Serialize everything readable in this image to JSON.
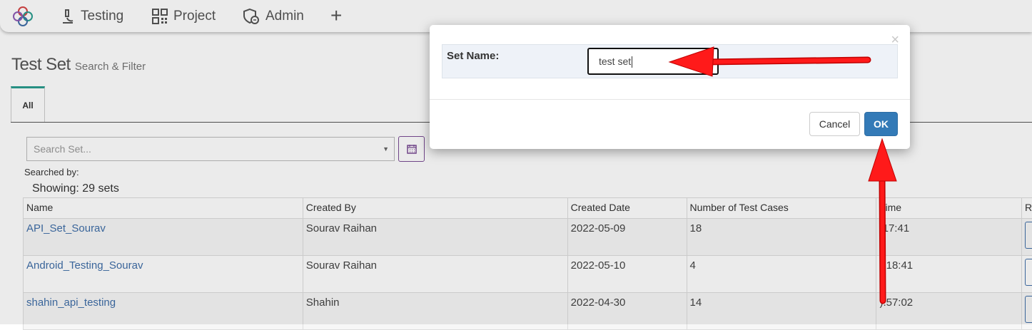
{
  "nav": {
    "items": [
      {
        "label": "Testing",
        "icon": "microscope-icon"
      },
      {
        "label": "Project",
        "icon": "qr-code-icon"
      },
      {
        "label": "Admin",
        "icon": "admin-shield-icon"
      }
    ],
    "add_label": "+"
  },
  "page": {
    "title": "Test Set",
    "subtitle": "Search & Filter",
    "tabs": [
      {
        "label": "All",
        "active": true
      }
    ],
    "search": {
      "placeholder": "Search Set..."
    },
    "searched_by": "Searched by:",
    "showing": "Showing: 29 sets"
  },
  "table": {
    "headers": [
      "Name",
      "Created By",
      "Created Date",
      "Number of Test Cases",
      "Time",
      "R"
    ],
    "rows": [
      {
        "name": "API_Set_Sourav",
        "created_by": "Sourav Raihan",
        "created_date": "2022-05-09",
        "num_cases": "18",
        "time": ":17:41"
      },
      {
        "name": "Android_Testing_Sourav",
        "created_by": "Sourav Raihan",
        "created_date": "2022-05-10",
        "num_cases": "4",
        "time": "):18:41"
      },
      {
        "name": "shahin_api_testing",
        "created_by": "Shahin",
        "created_date": "2022-04-30",
        "num_cases": "14",
        "time": "):57:02"
      }
    ]
  },
  "modal": {
    "label": "Set Name:",
    "input_value": "test set",
    "cancel_label": "Cancel",
    "ok_label": "OK",
    "close_label": "×"
  },
  "colors": {
    "primary_button": "#337ab7",
    "link": "#3f6ea8",
    "tab_accent": "#2a9d8f",
    "annotation_arrow": "#ff0000"
  }
}
